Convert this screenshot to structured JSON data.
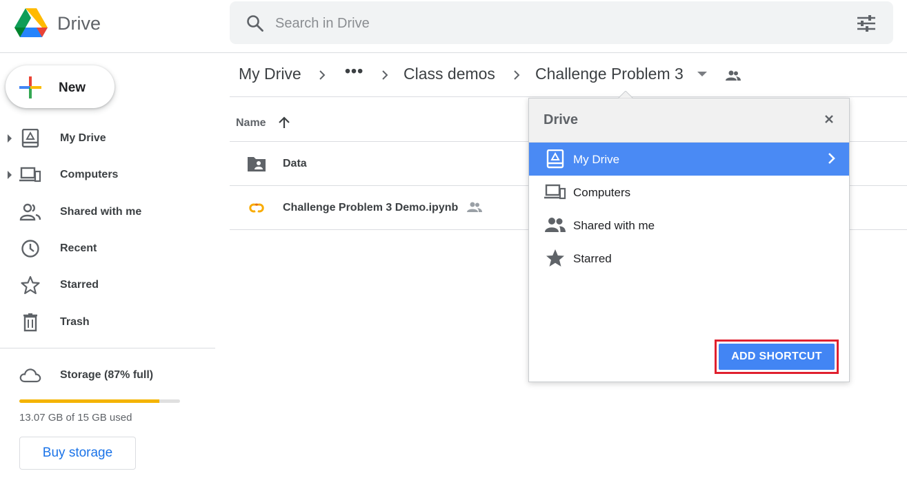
{
  "app": {
    "name": "Drive",
    "logo_icon": "google-drive-logo"
  },
  "search": {
    "placeholder": "Search in Drive",
    "value": "",
    "icons": [
      "search-icon",
      "filter-options-icon"
    ]
  },
  "sidebar": {
    "new_label": "New",
    "items": [
      {
        "label": "My Drive",
        "icon": "my-drive-icon",
        "expandable": true
      },
      {
        "label": "Computers",
        "icon": "computers-icon",
        "expandable": true
      },
      {
        "label": "Shared with me",
        "icon": "people-icon"
      },
      {
        "label": "Recent",
        "icon": "clock-icon"
      },
      {
        "label": "Starred",
        "icon": "star-outline-icon"
      },
      {
        "label": "Trash",
        "icon": "trash-icon"
      }
    ],
    "storage": {
      "label": "Storage (87% full)",
      "icon": "cloud-icon",
      "fraction_used": 0.87,
      "usage_text": "13.07 GB of 15 GB used",
      "buy_label": "Buy storage"
    }
  },
  "breadcrumb": {
    "items": [
      "My Drive",
      "•••",
      "Class demos",
      "Challenge Problem 3"
    ],
    "dropdown_icon": "caret-down-icon",
    "shared_icon": "people-icon"
  },
  "file_list": {
    "column_name": "Name",
    "sort": "ascending",
    "files": [
      {
        "name": "Data",
        "icon": "shared-folder-icon"
      },
      {
        "name": "Challenge Problem 3 Demo.ipynb",
        "icon": "colab-icon",
        "shared": true
      }
    ]
  },
  "dialog": {
    "title": "Drive",
    "items": [
      {
        "label": "My Drive",
        "icon": "my-drive-icon",
        "selected": true
      },
      {
        "label": "Computers",
        "icon": "computers-icon"
      },
      {
        "label": "Shared with me",
        "icon": "people-icon"
      },
      {
        "label": "Starred",
        "icon": "star-icon"
      }
    ],
    "action_label": "ADD SHORTCUT"
  },
  "colors": {
    "accent": "#4285f4",
    "selected_row": "#4a8af4",
    "highlight_frame": "#e0202e",
    "storage_bar": "#f4b400",
    "link": "#1a73e8"
  }
}
